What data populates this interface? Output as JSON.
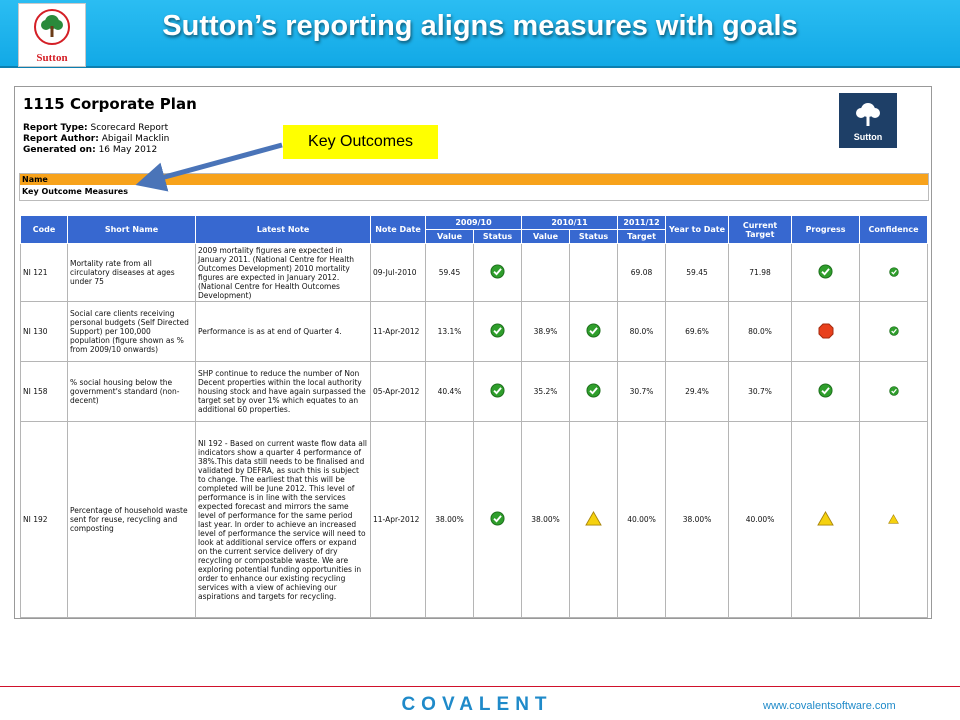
{
  "slide": {
    "title": "Sutton’s reporting aligns measures with goals",
    "logo_text": "Sutton",
    "callout": "Key Outcomes",
    "footer_brand": "COVALENT",
    "footer_url": "www.covalentsoftware.com"
  },
  "report": {
    "title": "1115 Corporate Plan",
    "type_label": "Report Type:",
    "type_value": "Scorecard Report",
    "author_label": "Report Author:",
    "author_value": "Abigail Macklin",
    "generated_label": "Generated on:",
    "generated_value": "16 May 2012",
    "logo_word": "Sutton",
    "name_header": "Name",
    "name_value": "Key Outcome Measures"
  },
  "table": {
    "headers": {
      "code": "Code",
      "short_name": "Short Name",
      "latest_note": "Latest Note",
      "note_date": "Note Date",
      "y2009": "2009/10",
      "y2010": "2010/11",
      "y2011": "2011/12",
      "ytd": "Year to Date",
      "current_target": "Current Target",
      "progress": "Progress",
      "confidence": "Confidence",
      "value": "Value",
      "status": "Status",
      "target": "Target"
    },
    "rows": [
      {
        "code": "NI 121",
        "short_name": "Mortality rate from all circulatory diseases at ages under 75",
        "note": "2009 mortality figures are expected in January 2011. (National Centre for Health Outcomes Development) 2010 mortality figures are expected in January 2012. (National Centre for Health Outcomes Development)",
        "note_italic": false,
        "note_date": "09-Jul-2010",
        "v2009": "59.45",
        "s2009": "ok",
        "v2010": "",
        "s2010": "",
        "t2011": "69.08",
        "ytd": "59.45",
        "current_target": "71.98",
        "progress": "ok",
        "confidence": "ok"
      },
      {
        "code": "NI 130",
        "short_name": "Social care clients receiving personal budgets (Self Directed Support) per 100,000 population (figure shown as % from 2009/10 onwards)",
        "note": "Performance is as at end of Quarter 4.",
        "note_italic": false,
        "note_date": "11-Apr-2012",
        "v2009": "13.1%",
        "s2009": "ok",
        "v2010": "38.9%",
        "s2010": "ok",
        "t2011": "80.0%",
        "ytd": "69.6%",
        "current_target": "80.0%",
        "progress": "stop",
        "confidence": "ok"
      },
      {
        "code": "NI 158",
        "short_name": "% social housing below the government's standard (non-decent)",
        "note": "SHP continue to reduce the number of Non Decent properties within the local authority housing stock and have again surpassed the target set by over 1% which equates to an additional 60 properties.",
        "note_italic": false,
        "note_date": "05-Apr-2012",
        "v2009": "40.4%",
        "s2009": "ok",
        "v2010": "35.2%",
        "s2010": "ok",
        "t2011": "30.7%",
        "ytd": "29.4%",
        "current_target": "30.7%",
        "progress": "ok",
        "confidence": "ok"
      },
      {
        "code": "NI 192",
        "short_name": "Percentage of household waste sent for reuse, recycling and composting",
        "note": "NI 192 - Based on current waste flow data all indicators show a quarter 4 performance of 38%.This data still needs to be finalised and validated by DEFRA, as such this is subject to change. The earliest that this will be completed will be June 2012. This level of performance is in line with the services expected forecast and mirrors the same level of performance for the same period last year. In order to achieve an increased level of performance the service will need to look at additional service offers or expand on the current service delivery of dry recycling or compostable waste. We are exploring potential funding opportunities in order to enhance our existing recycling services with a view of achieving our aspirations and targets for recycling.",
        "note_italic": true,
        "note_date": "11-Apr-2012",
        "v2009": "38.00%",
        "s2009": "ok",
        "v2010": "38.00%",
        "s2010": "warn",
        "t2011": "40.00%",
        "ytd": "38.00%",
        "current_target": "40.00%",
        "progress": "warn",
        "confidence": "warn"
      }
    ]
  },
  "icons": {
    "ok": "green-check-icon",
    "stop": "red-octagon-icon",
    "warn": "amber-triangle-icon"
  },
  "colors": {
    "header_blue": "#12a9e6",
    "table_header": "#3768d0",
    "name_bar": "#f7a21b",
    "callout": "#ffff00",
    "brand_red": "#d41f26",
    "footer_red": "#d0112b",
    "link_blue": "#1f8ac9"
  }
}
